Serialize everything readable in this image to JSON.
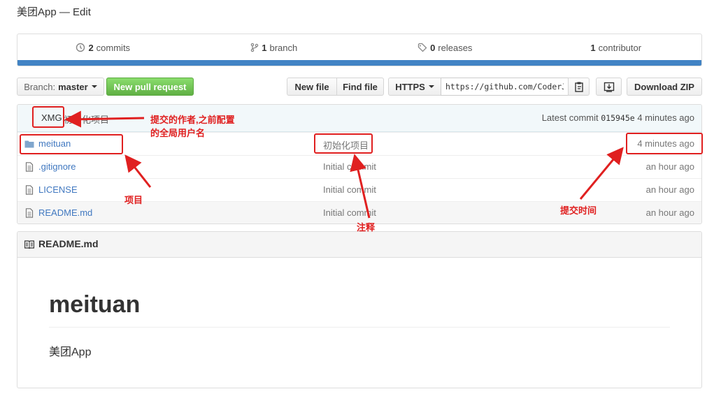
{
  "page": {
    "title": "美团App",
    "separator": "—",
    "edit_label": "Edit"
  },
  "summary": {
    "commits": {
      "count": "2",
      "label": "commits"
    },
    "branches": {
      "count": "1",
      "label": "branch"
    },
    "releases": {
      "count": "0",
      "label": "releases"
    },
    "contributors": {
      "count": "1",
      "label": "contributor"
    },
    "accent_color": "#4183c4"
  },
  "toolbar": {
    "branch_prefix": "Branch:",
    "branch_name": "master",
    "pull_request_label": "New pull request",
    "new_file_label": "New file",
    "find_file_label": "Find file",
    "protocol_label": "HTTPS",
    "clone_url": "https://github.com/CoderJ",
    "download_zip_label": "Download ZIP"
  },
  "latest_commit": {
    "author": "XMG",
    "message": "初始化项目",
    "prefix": "Latest commit",
    "sha": "015945e",
    "age": "4 minutes ago"
  },
  "files": [
    {
      "name": "meituan",
      "type": "folder",
      "message": "初始化项目",
      "age": "4 minutes ago"
    },
    {
      "name": ".gitignore",
      "type": "file",
      "message": "Initial commit",
      "age": "an hour ago"
    },
    {
      "name": "LICENSE",
      "type": "file",
      "message": "Initial commit",
      "age": "an hour ago"
    },
    {
      "name": "README.md",
      "type": "file",
      "message": "Initial commit",
      "age": "an hour ago"
    }
  ],
  "readme": {
    "header": "README.md",
    "heading": "meituan",
    "body": "美团App"
  },
  "annotations": {
    "author_note_line1": "提交的作者,之前配置",
    "author_note_line2": "的全局用户名",
    "project_note": "项目",
    "comment_note": "注释",
    "time_note": "提交时间",
    "color": "#e02020"
  }
}
